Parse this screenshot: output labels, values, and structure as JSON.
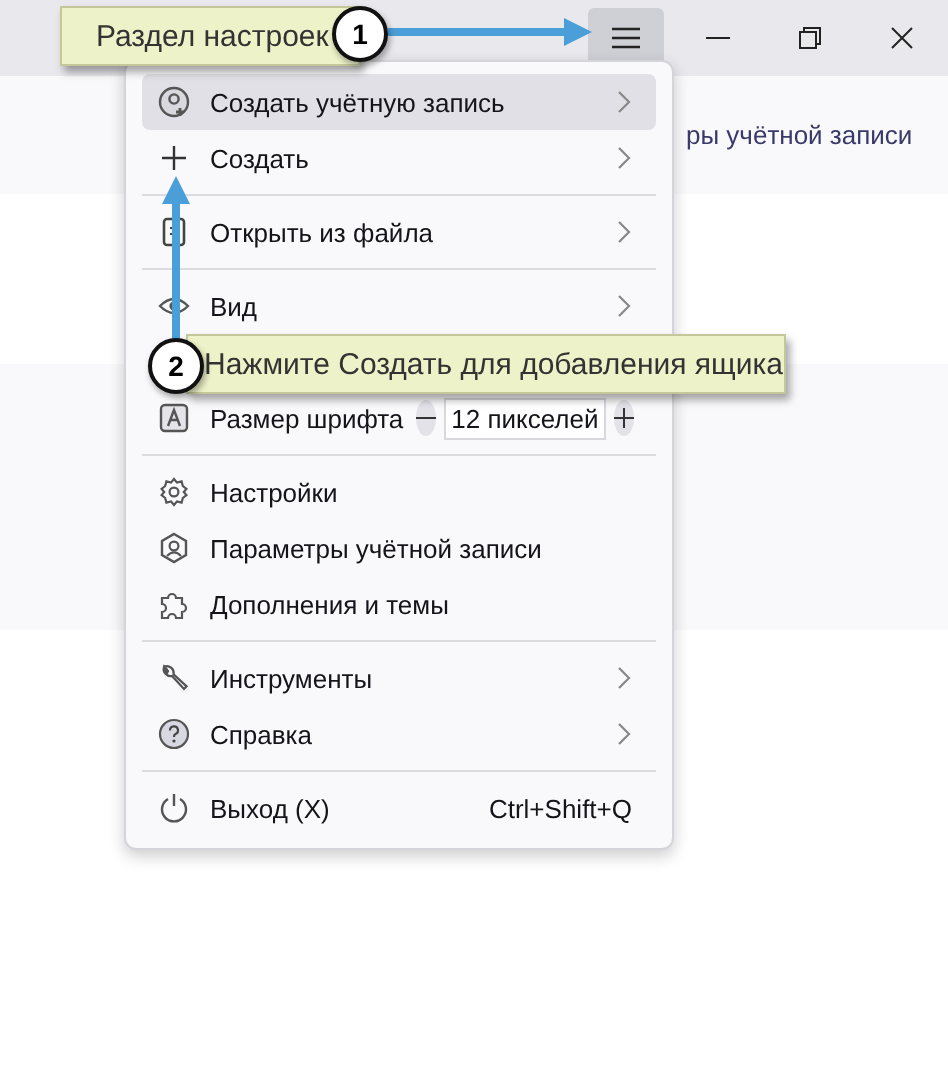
{
  "window": {
    "menu_button": {
      "pressed": true
    }
  },
  "background": {
    "account_link": "ры учётной записи"
  },
  "menu": {
    "items": [
      {
        "kind": "item",
        "label": "Создать учётную запись",
        "submenu": true,
        "selected": true
      },
      {
        "kind": "item",
        "label": "Создать",
        "submenu": true,
        "selected": false
      },
      {
        "kind": "separator"
      },
      {
        "kind": "item",
        "label": "Открыть из файла",
        "submenu": true,
        "selected": false
      },
      {
        "kind": "separator"
      },
      {
        "kind": "item",
        "label": "Вид",
        "submenu": true,
        "selected": false
      },
      {
        "kind": "covered"
      },
      {
        "kind": "zoom",
        "label": "Размер шрифта",
        "value": "12 пикселей"
      },
      {
        "kind": "separator"
      },
      {
        "kind": "item",
        "label": "Настройки",
        "submenu": false,
        "selected": false
      },
      {
        "kind": "item",
        "label": "Параметры учётной записи",
        "submenu": false,
        "selected": false
      },
      {
        "kind": "item",
        "label": "Дополнения и темы",
        "submenu": false,
        "selected": false
      },
      {
        "kind": "separator"
      },
      {
        "kind": "item",
        "label": "Инструменты",
        "submenu": true,
        "selected": false
      },
      {
        "kind": "item",
        "label": "Справка",
        "submenu": true,
        "selected": false
      },
      {
        "kind": "separator"
      },
      {
        "kind": "item",
        "label": "Выход (X)",
        "submenu": false,
        "selected": false,
        "shortcut": "Ctrl+Shift+Q"
      }
    ]
  },
  "annotations": [
    {
      "number": "1",
      "text": "Раздел настроек"
    },
    {
      "number": "2",
      "text": "Нажмите Создать для добавления ящика"
    }
  ]
}
